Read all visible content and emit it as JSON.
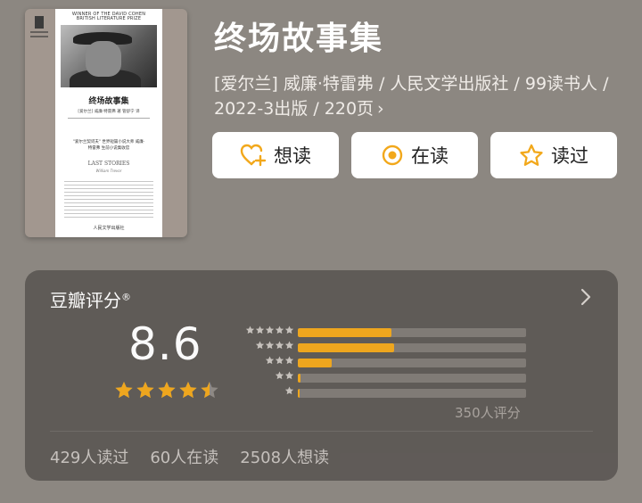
{
  "book": {
    "title": "终场故事集",
    "meta": "[爱尔兰] 威廉·特雷弗 / 人民文学出版社 / 99读书人 / 2022-3出版 / 220页",
    "meta_chevron": "›"
  },
  "cover": {
    "top_text": "WINNER OF THE DAVID COHEN BRITISH LITERATURE PRIZE",
    "title": "终场故事集",
    "authors": "[爱尔兰] 威廉·特雷弗 著   管舒宁 译",
    "quote": "\"爱尔兰契诃夫\" 世界短篇小说大师 威廉·特雷弗 生前小说集收官",
    "en_title": "LAST STORIES",
    "en_author": "William Trevor",
    "publisher": "人民文学出版社"
  },
  "actions": {
    "want_label": "想读",
    "reading_label": "在读",
    "read_label": "读过"
  },
  "rating": {
    "title": "豆瓣评分",
    "registered": "®",
    "score": "8.6",
    "stars": 4.5,
    "histogram": [
      {
        "stars": 5,
        "fraction": 0.41
      },
      {
        "stars": 4,
        "fraction": 0.42
      },
      {
        "stars": 3,
        "fraction": 0.15
      },
      {
        "stars": 2,
        "fraction": 0.01
      },
      {
        "stars": 1,
        "fraction": 0.005
      }
    ],
    "raters": "350人评分"
  },
  "stats": {
    "read": "429人读过",
    "reading": "60人在读",
    "want": "2508人想读"
  },
  "colors": {
    "accent": "#f2a81b",
    "background": "#8c8781",
    "panel": "#5e5a56"
  }
}
